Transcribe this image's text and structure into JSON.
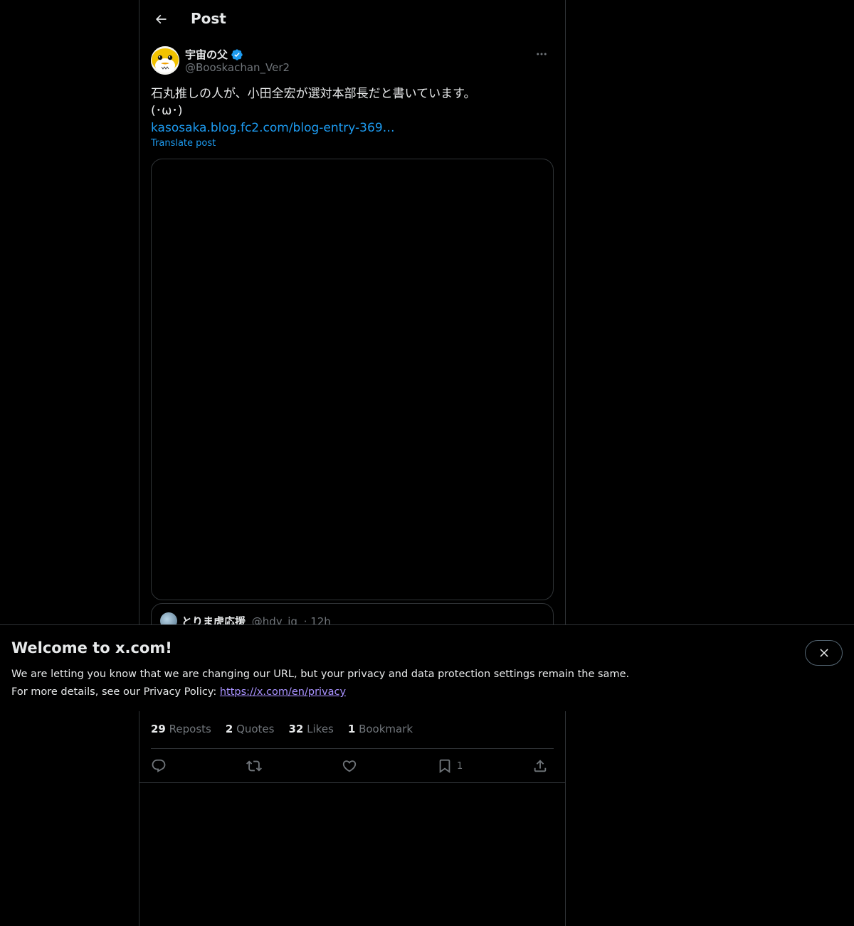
{
  "header": {
    "title": "Post"
  },
  "author": {
    "display_name": "宇宙の父",
    "handle": "@Booskachan_Ver2"
  },
  "post": {
    "line1": "石丸推しの人が、小田全宏が選対本部長だと書いています。",
    "line2": "(･ω･)",
    "link": "kasosaka.blog.fc2.com/blog-entry-369…",
    "translate": "Translate post"
  },
  "quote": {
    "name": "とりま虎応援",
    "handle": "@hdy_ig",
    "time": "· 12h"
  },
  "stats": {
    "reposts_count": "29",
    "reposts_label": "Reposts",
    "quotes_count": "2",
    "quotes_label": "Quotes",
    "likes_count": "32",
    "likes_label": "Likes",
    "bookmarks_count": "1",
    "bookmarks_label": "Bookmark"
  },
  "actions": {
    "bookmark_count": "1"
  },
  "banner": {
    "title": "Welcome to x.com!",
    "line1": "We are letting you know that we are changing our URL, but your privacy and data protection settings remain the same.",
    "line2_prefix": "For more details, see our Privacy Policy: ",
    "link": "https://x.com/en/privacy"
  },
  "colors": {
    "background": "#000000",
    "text": "#e7e9ea",
    "muted": "#71767b",
    "accent": "#1d9bf0",
    "verified": "#1d9bf0",
    "border": "#2f3336",
    "banner_link": "#a992ff"
  },
  "icons": {
    "back": "back-arrow-icon",
    "verified": "verified-badge-icon",
    "more": "more-icon",
    "reply": "reply-icon",
    "repost": "repost-icon",
    "like": "like-icon",
    "bookmark": "bookmark-icon",
    "share": "share-icon",
    "close": "close-icon"
  }
}
